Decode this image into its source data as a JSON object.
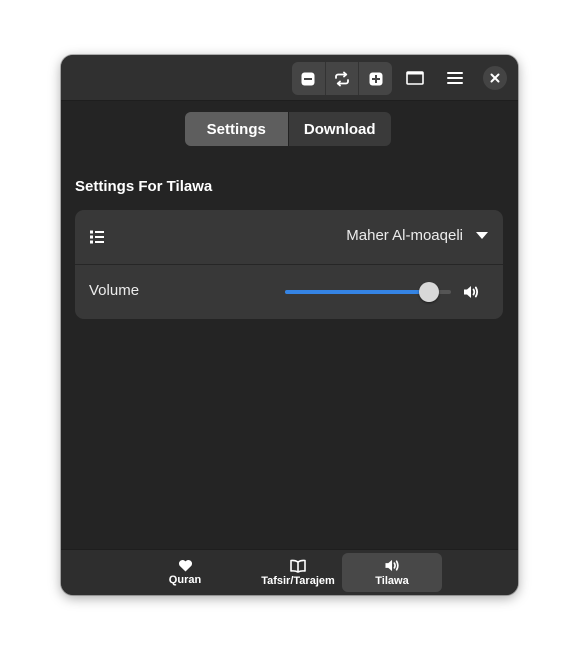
{
  "switcher": {
    "settings_label": "Settings",
    "download_label": "Download",
    "active": "Settings"
  },
  "section": {
    "title": "Settings For Tilawa"
  },
  "reciter_row": {
    "icon": "list-icon",
    "selected_reciter": "Maher Al-moaqeli",
    "dropdown_icon": "pan-down-icon"
  },
  "volume_row": {
    "label": "Volume",
    "level": 0.92,
    "icon": "speaker-icon"
  },
  "headerbar": {
    "icons": [
      "zoom-out-icon",
      "repeat-icon",
      "zoom-in-icon",
      "window-icon",
      "menu-icon",
      "close-icon"
    ]
  },
  "bottom_nav": {
    "items": [
      {
        "label": "Quran",
        "icon": "heart-icon",
        "active": false
      },
      {
        "label": "Tafsir/Tarajem",
        "icon": "book-icon",
        "active": false
      },
      {
        "label": "Tilawa",
        "icon": "speaker-icon",
        "active": true
      }
    ]
  },
  "colors": {
    "accent": "#3584e4",
    "window_bg": "#242424",
    "card_bg": "#383838"
  }
}
